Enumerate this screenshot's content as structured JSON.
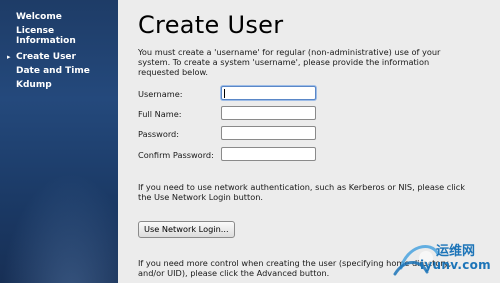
{
  "sidebar": {
    "items": [
      {
        "label": "Welcome",
        "current": false
      },
      {
        "label": "License Information",
        "current": false
      },
      {
        "label": "Create User",
        "current": true
      },
      {
        "label": "Date and Time",
        "current": false
      },
      {
        "label": "Kdump",
        "current": false
      }
    ],
    "current_marker": "▸"
  },
  "page": {
    "title": "Create User",
    "intro": "You must create a 'username' for regular (non-administrative) use of your system.  To create a system 'username', please provide the information requested below."
  },
  "form": {
    "username_label": "Username:",
    "username_value": "",
    "fullname_label": "Full Name:",
    "fullname_value": "",
    "password_label": "Password:",
    "password_value": "",
    "confirm_label": "Confirm Password:",
    "confirm_value": ""
  },
  "network": {
    "text": "If you need to use network authentication, such as Kerberos or NIS, please click the Use Network Login button.",
    "button_label": "Use Network Login..."
  },
  "advanced": {
    "text": "If you need more control when creating the user (specifying home directory, and/or UID), please click the Advanced button."
  },
  "watermark": {
    "brand_cn": "运维网",
    "url": "iyunv.com"
  },
  "colors": {
    "sidebar_bg": "#1e3c67",
    "content_bg": "#ececec",
    "focus_border": "#5a87c7",
    "watermark": "#1c74b8"
  }
}
